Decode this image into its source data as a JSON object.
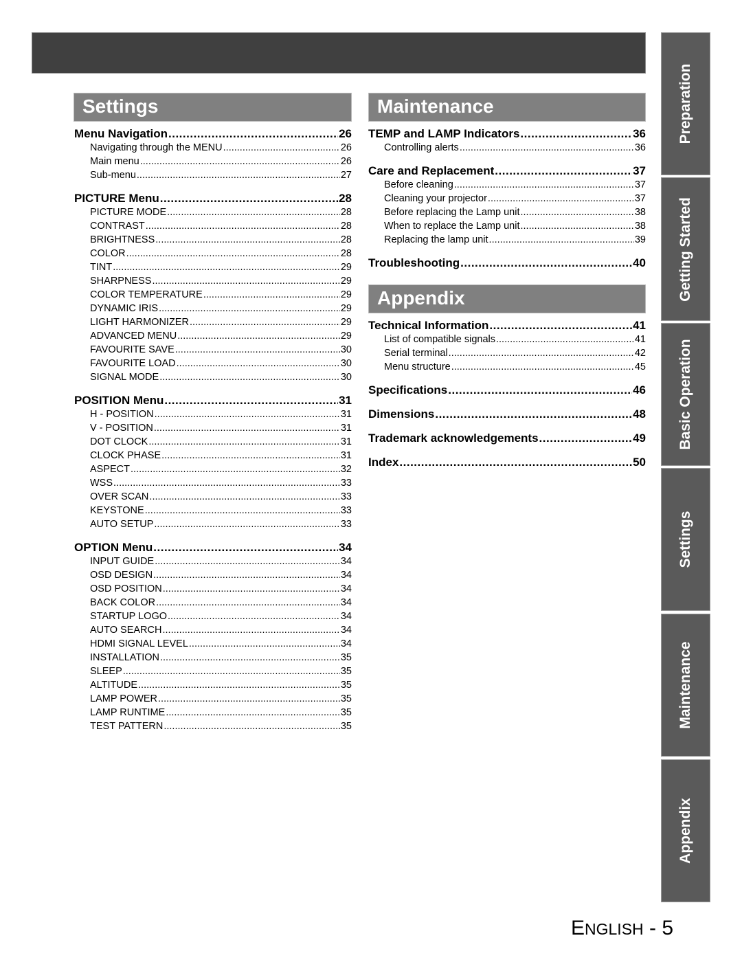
{
  "header_bar": {},
  "left": {
    "section_title": "Settings",
    "groups": [
      {
        "title": "Menu Navigation",
        "page": "26",
        "items": [
          {
            "label": "Navigating through the MENU",
            "page": "26"
          },
          {
            "label": "Main menu",
            "page": "26"
          },
          {
            "label": "Sub-menu",
            "page": "27"
          }
        ]
      },
      {
        "title": "PICTURE Menu",
        "page": "28",
        "items": [
          {
            "label": "PICTURE MODE",
            "page": "28"
          },
          {
            "label": "CONTRAST",
            "page": "28"
          },
          {
            "label": "BRIGHTNESS",
            "page": "28"
          },
          {
            "label": "COLOR",
            "page": "28"
          },
          {
            "label": "TINT",
            "page": "29"
          },
          {
            "label": "SHARPNESS",
            "page": "29"
          },
          {
            "label": "COLOR TEMPERATURE",
            "page": "29"
          },
          {
            "label": "DYNAMIC IRIS",
            "page": "29"
          },
          {
            "label": "LIGHT HARMONIZER",
            "page": "29"
          },
          {
            "label": "ADVANCED MENU",
            "page": "29"
          },
          {
            "label": "FAVOURITE SAVE",
            "page": "30"
          },
          {
            "label": "FAVOURITE LOAD",
            "page": "30"
          },
          {
            "label": "SIGNAL MODE",
            "page": "30"
          }
        ]
      },
      {
        "title": "POSITION Menu",
        "page": "31",
        "items": [
          {
            "label": "H - POSITION",
            "page": "31"
          },
          {
            "label": "V - POSITION",
            "page": "31"
          },
          {
            "label": "DOT CLOCK",
            "page": "31"
          },
          {
            "label": "CLOCK PHASE",
            "page": "31"
          },
          {
            "label": "ASPECT",
            "page": "32"
          },
          {
            "label": "WSS",
            "page": "33"
          },
          {
            "label": "OVER SCAN",
            "page": "33"
          },
          {
            "label": "KEYSTONE",
            "page": "33"
          },
          {
            "label": "AUTO SETUP",
            "page": "33"
          }
        ]
      },
      {
        "title": "OPTION Menu",
        "page": "34",
        "items": [
          {
            "label": "INPUT GUIDE",
            "page": "34"
          },
          {
            "label": "OSD DESIGN",
            "page": "34"
          },
          {
            "label": "OSD POSITION",
            "page": "34"
          },
          {
            "label": "BACK COLOR",
            "page": "34"
          },
          {
            "label": "STARTUP LOGO",
            "page": "34"
          },
          {
            "label": "AUTO SEARCH",
            "page": "34"
          },
          {
            "label": "HDMI SIGNAL LEVEL",
            "page": "34"
          },
          {
            "label": "INSTALLATION",
            "page": "35"
          },
          {
            "label": "SLEEP",
            "page": "35"
          },
          {
            "label": "ALTITUDE",
            "page": "35"
          },
          {
            "label": "LAMP POWER",
            "page": "35"
          },
          {
            "label": "LAMP RUNTIME",
            "page": "35"
          },
          {
            "label": "TEST PATTERN",
            "page": "35"
          }
        ]
      }
    ]
  },
  "right": {
    "maintenance": {
      "section_title": "Maintenance",
      "groups": [
        {
          "title": "TEMP and LAMP Indicators",
          "page": "36",
          "items": [
            {
              "label": "Controlling alerts",
              "page": "36"
            }
          ]
        },
        {
          "title": "Care and Replacement",
          "page": "37",
          "items": [
            {
              "label": "Before cleaning",
              "page": "37"
            },
            {
              "label": "Cleaning your projector",
              "page": "37"
            },
            {
              "label": "Before replacing the Lamp unit",
              "page": "38"
            },
            {
              "label": "When to replace the Lamp unit",
              "page": "38"
            },
            {
              "label": "Replacing the lamp unit",
              "page": "39"
            }
          ]
        },
        {
          "title": "Troubleshooting",
          "page": "40",
          "items": []
        }
      ]
    },
    "appendix": {
      "section_title": "Appendix",
      "groups": [
        {
          "title": "Technical Information",
          "page": "41",
          "items": [
            {
              "label": "List of compatible signals",
              "page": "41"
            },
            {
              "label": "Serial terminal",
              "page": "42"
            },
            {
              "label": "Menu structure",
              "page": "45"
            }
          ]
        },
        {
          "title": "Specifications",
          "page": "46",
          "items": []
        },
        {
          "title": "Dimensions",
          "page": "48",
          "items": []
        },
        {
          "title": "Trademark acknowledgements",
          "page": "49",
          "items": []
        },
        {
          "title": "Index",
          "page": "50",
          "items": []
        }
      ]
    }
  },
  "side_tabs": [
    "Preparation",
    "Getting Started",
    "Basic Operation",
    "Settings",
    "Maintenance",
    "Appendix"
  ],
  "footer": {
    "lang_first": "E",
    "lang_rest": "NGLISH",
    "separator": " - ",
    "page_number": "5"
  },
  "colors": {
    "header_bar": "#404040",
    "section_header": "#808080",
    "side_tab": "#5a5a5a"
  }
}
